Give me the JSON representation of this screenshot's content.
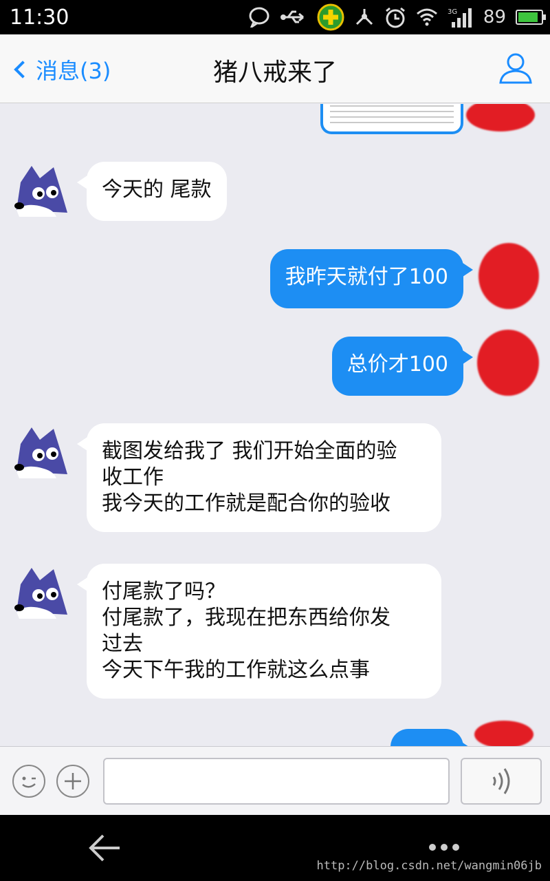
{
  "status_bar": {
    "time": "11:30",
    "battery": "89",
    "battery_fraction": 0.89,
    "icons": [
      "chat-bubble-icon",
      "usb-icon",
      "security-plus-icon",
      "share-icon",
      "alarm-icon",
      "wifi-icon",
      "signal-3g-icon",
      "battery-icon"
    ]
  },
  "header": {
    "back_label": "消息(3)",
    "title": "猪八戒来了",
    "profile_icon": "person-icon"
  },
  "messages": [
    {
      "direction": "incoming",
      "lines": [
        "今天的 尾款"
      ]
    },
    {
      "direction": "outgoing",
      "lines": [
        "我昨天就付了100"
      ]
    },
    {
      "direction": "outgoing",
      "lines": [
        "总价才100"
      ]
    },
    {
      "direction": "incoming",
      "lines": [
        "截图发给我了 我们开始全面的验",
        "收工作",
        "我今天的工作就是配合你的验收"
      ]
    },
    {
      "direction": "incoming",
      "lines": [
        "付尾款了吗？",
        "付尾款了，我现在把东西给你发",
        "过去",
        "今天下午我的工作就这么点事"
      ]
    }
  ],
  "input_bar": {
    "emoji_icon": "emoji-icon",
    "plus_icon": "plus-icon",
    "voice_icon": "voice-icon",
    "placeholder": ""
  },
  "nav_bar": {
    "back_icon": "back-arrow-icon",
    "menu_icon": "more-dots-icon"
  },
  "watermark": "http://blog.csdn.net/wangmin06jb",
  "colors": {
    "accent": "#1a8cff",
    "outgoing_bubble": "#1d8ef3",
    "incoming_bubble": "#ffffff",
    "background": "#ebebf1",
    "redaction": "#e21d24"
  }
}
